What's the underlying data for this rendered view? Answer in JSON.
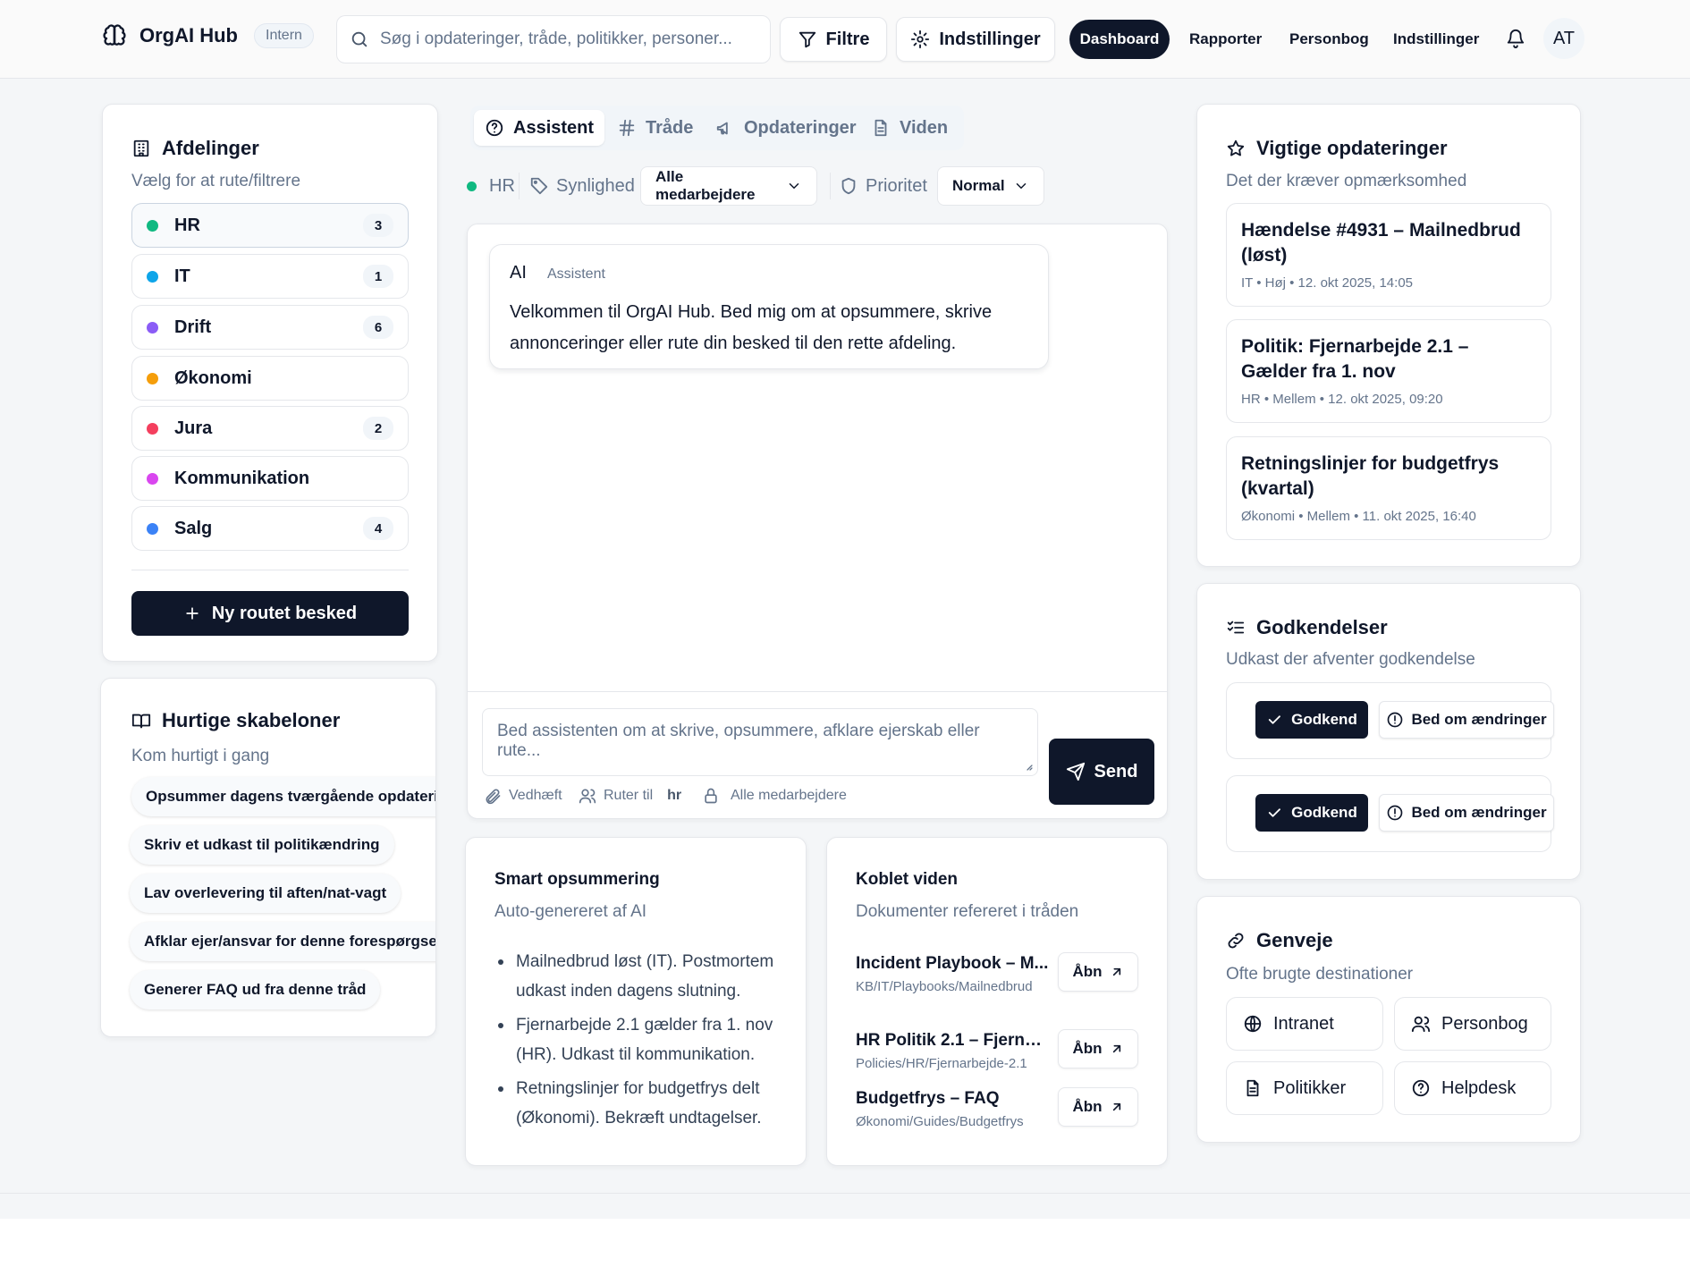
{
  "header": {
    "brand": "OrgAI Hub",
    "badge": "Intern",
    "search_placeholder": "Søg i opdateringer, tråde, politikker, personer...",
    "filters_label": "Filtre",
    "settings_label": "Indstillinger",
    "nav": {
      "dashboard": "Dashboard",
      "reports": "Rapporter",
      "people": "Personbog",
      "settings": "Indstillinger"
    },
    "avatar": "AT"
  },
  "departments": {
    "title": "Afdelinger",
    "subtitle": "Vælg for at rute/filtrere",
    "items": [
      {
        "label": "HR",
        "count": "3",
        "color": "#10b981"
      },
      {
        "label": "IT",
        "count": "1",
        "color": "#0ea5e9"
      },
      {
        "label": "Drift",
        "count": "6",
        "color": "#8b5cf6"
      },
      {
        "label": "Økonomi",
        "count": "",
        "color": "#f59e0b"
      },
      {
        "label": "Jura",
        "count": "2",
        "color": "#f43f5e"
      },
      {
        "label": "Kommunikation",
        "count": "",
        "color": "#d946ef"
      },
      {
        "label": "Salg",
        "count": "4",
        "color": "#3b82f6"
      }
    ],
    "new_message": "Ny routet besked"
  },
  "templates": {
    "title": "Hurtige skabeloner",
    "subtitle": "Kom hurtigt i gang",
    "items": [
      "Opsummer dagens tværgående opdateringer",
      "Skriv et udkast til politikændring",
      "Lav overlevering til aften/nat-vagt",
      "Afklar ejer/ansvar for denne forespørgsel",
      "Generer FAQ ud fra denne tråd"
    ]
  },
  "tabs": {
    "assistant": "Assistent",
    "threads": "Tråde",
    "updates": "Opdateringer",
    "knowledge": "Viden"
  },
  "filterbar": {
    "dept": "HR",
    "visibility_label": "Synlighed",
    "visibility_value": "Alle medarbejdere",
    "priority_label": "Prioritet",
    "priority_value": "Normal"
  },
  "chat": {
    "ai_badge": "AI",
    "ai_role": "Assistent",
    "ai_message": "Velkommen til OrgAI Hub. Bed mig om at opsummere, skrive annonceringer eller rute din besked til den rette afdeling.",
    "input_placeholder": "Bed assistenten om at skrive, opsummere, afklare ejerskab eller rute...",
    "send": "Send",
    "attach": "Vedhæft",
    "route_to": "Ruter til",
    "route_dept": "hr",
    "audience": "Alle medarbejdere"
  },
  "summary": {
    "title": "Smart opsummering",
    "subtitle": "Auto-genereret af AI",
    "bullets": [
      "Mailnedbrud løst (IT). Postmortem udkast inden dagens slutning.",
      "Fjernarbejde 2.1 gælder fra 1. nov (HR). Udkast til kommunikation.",
      "Retningslinjer for budgetfrys delt (Økonomi). Bekræft undtagelser."
    ]
  },
  "knowledge": {
    "title": "Koblet viden",
    "subtitle": "Dokumenter refereret i tråden",
    "open_label": "Åbn",
    "items": [
      {
        "title": "Incident Playbook – M...",
        "path": "KB/IT/Playbooks/Mailnedbrud"
      },
      {
        "title": "HR Politik 2.1 – Fjernar...",
        "path": "Policies/HR/Fjernarbejde-2.1"
      },
      {
        "title": "Budgetfrys – FAQ",
        "path": "Økonomi/Guides/Budgetfrys"
      }
    ]
  },
  "important": {
    "title": "Vigtige opdateringer",
    "subtitle": "Det der kræver opmærksomhed",
    "items": [
      {
        "title": "Hændelse #4931 – Mailnedbrud (løst)",
        "meta": "IT • Høj • 12. okt 2025, 14:05"
      },
      {
        "title": "Politik: Fjernarbejde 2.1 – Gælder fra 1. nov",
        "meta": "HR • Mellem • 12. okt 2025, 09:20"
      },
      {
        "title": "Retningslinjer for budgetfrys (kvartal)",
        "meta": "Økonomi • Mellem • 11. okt 2025, 16:40"
      }
    ]
  },
  "approvals": {
    "title": "Godkendelser",
    "subtitle": "Udkast der afventer godkendelse",
    "approve": "Godkend",
    "request_changes": "Bed om ændringer"
  },
  "shortcuts": {
    "title": "Genveje",
    "subtitle": "Ofte brugte destinationer",
    "items": [
      "Intranet",
      "Personbog",
      "Politikker",
      "Helpdesk"
    ]
  }
}
